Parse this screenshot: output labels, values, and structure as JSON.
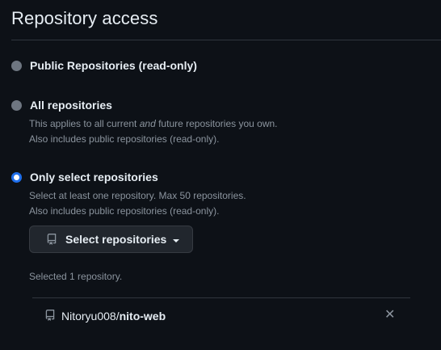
{
  "heading": "Repository access",
  "options": [
    {
      "label": "Public Repositories (read-only)",
      "checked": false
    },
    {
      "label": "All repositories",
      "checked": false,
      "note_line1_before": "This applies to all current ",
      "note_line1_em": "and",
      "note_line1_after": " future repositories you own.",
      "note_line2": "Also includes public repositories (read-only)."
    },
    {
      "label": "Only select repositories",
      "checked": true,
      "note_line1": "Select at least one repository. Max 50 repositories.",
      "note_line2": "Also includes public repositories (read-only)."
    }
  ],
  "select_button": {
    "label": "Select repositories",
    "icon": "repo-icon",
    "caret_icon": "triangle-down-icon"
  },
  "selected_count": "Selected 1 repository.",
  "selected_repos": [
    {
      "owner": "Nitoryu008",
      "separator": "/",
      "name": "nito-web",
      "icon": "repo-icon",
      "remove_icon": "x-icon",
      "remove_glyph": "✕"
    }
  ],
  "colors": {
    "background": "#0d1117",
    "text": "#e6edf3",
    "muted": "#8b949e",
    "border": "#30363d",
    "accent": "#1f6feb",
    "button_bg": "#21262d"
  }
}
